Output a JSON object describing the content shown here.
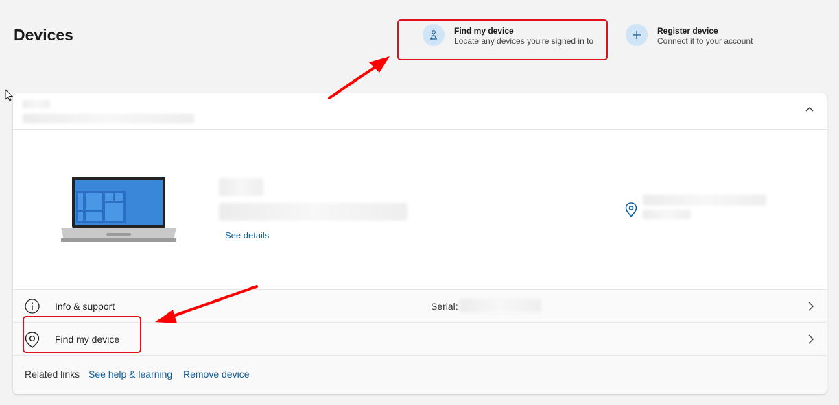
{
  "page": {
    "title": "Devices"
  },
  "actions": {
    "find_my_device": {
      "title": "Find my device",
      "subtitle": "Locate any devices you're signed in to"
    },
    "register_device": {
      "title": "Register device",
      "subtitle": "Connect it to your account"
    }
  },
  "device_card": {
    "see_details": "See details"
  },
  "rows": {
    "info_support": {
      "label": "Info & support",
      "serial_label": "Serial:"
    },
    "find_my_device": {
      "label": "Find my device"
    }
  },
  "related_links": {
    "label": "Related links",
    "help": "See help & learning",
    "remove": "Remove device"
  },
  "colors": {
    "accent": "#0f5e9c",
    "highlight": "#e0101a",
    "icon_circle": "#cfe4f7"
  }
}
